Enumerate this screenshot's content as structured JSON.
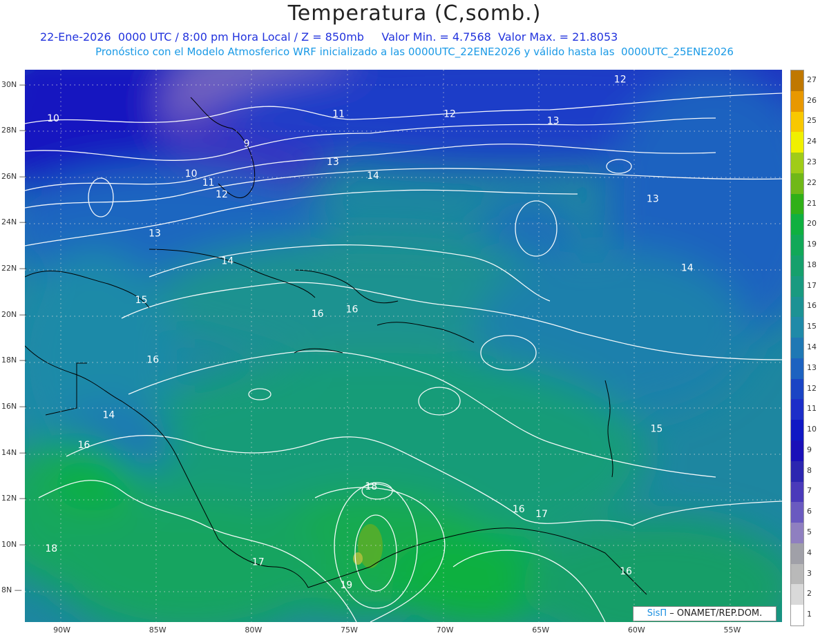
{
  "title": "Temperatura (C,somb.)",
  "subtitle_line1": "22-Ene-2026  0000 UTC / 8:00 pm Hora Local / Z = 850mb     Valor Min. = 4.7568  Valor Max. = 21.8053",
  "subtitle_line2": "Pronóstico con el Modelo Atmosferico WRF inicializado a las 0000UTC_22ENE2026 y válido hasta las  0000UTC_25ENE2026",
  "axes": {
    "lon_labels": [
      "90W",
      "85W",
      "80W",
      "75W",
      "70W",
      "65W",
      "60W",
      "55W"
    ],
    "lat_labels": [
      "30N",
      "28N",
      "26N",
      "24N",
      "22N",
      "20N",
      "18N",
      "16N",
      "14N",
      "12N",
      "10N",
      "8N"
    ],
    "grid": "dotted"
  },
  "contour_labels": [
    {
      "text": "12",
      "lon": -60.8,
      "lat": 30.1
    },
    {
      "text": "10",
      "lon": -90.4,
      "lat": 28.4
    },
    {
      "text": "11",
      "lon": -75.5,
      "lat": 28.6
    },
    {
      "text": "12",
      "lon": -69.7,
      "lat": 28.6
    },
    {
      "text": "13",
      "lon": -64.3,
      "lat": 28.3
    },
    {
      "text": "9",
      "lon": -80.3,
      "lat": 27.3
    },
    {
      "text": "13",
      "lon": -75.8,
      "lat": 26.5
    },
    {
      "text": "14",
      "lon": -73.7,
      "lat": 25.9
    },
    {
      "text": "10",
      "lon": -83.2,
      "lat": 26.0
    },
    {
      "text": "11",
      "lon": -82.3,
      "lat": 25.6
    },
    {
      "text": "12",
      "lon": -81.6,
      "lat": 25.1
    },
    {
      "text": "13",
      "lon": -59.1,
      "lat": 24.9
    },
    {
      "text": "13",
      "lon": -85.1,
      "lat": 23.4
    },
    {
      "text": "14",
      "lon": -81.3,
      "lat": 22.2
    },
    {
      "text": "14",
      "lon": -57.3,
      "lat": 21.9
    },
    {
      "text": "15",
      "lon": -85.8,
      "lat": 20.5
    },
    {
      "text": "16",
      "lon": -76.6,
      "lat": 19.9
    },
    {
      "text": "16",
      "lon": -74.8,
      "lat": 20.1
    },
    {
      "text": "16",
      "lon": -85.2,
      "lat": 17.9
    },
    {
      "text": "14",
      "lon": -87.5,
      "lat": 15.5
    },
    {
      "text": "15",
      "lon": -58.9,
      "lat": 14.9
    },
    {
      "text": "16",
      "lon": -88.8,
      "lat": 14.2
    },
    {
      "text": "18",
      "lon": -73.8,
      "lat": 12.4
    },
    {
      "text": "16",
      "lon": -66.1,
      "lat": 11.4
    },
    {
      "text": "17",
      "lon": -64.9,
      "lat": 11.2
    },
    {
      "text": "18",
      "lon": -90.5,
      "lat": 9.7
    },
    {
      "text": "17",
      "lon": -79.7,
      "lat": 9.1
    },
    {
      "text": "19",
      "lon": -75.1,
      "lat": 8.1
    },
    {
      "text": "16",
      "lon": -60.5,
      "lat": 8.7
    }
  ],
  "colorbar": {
    "labels": [
      "1",
      "2",
      "3",
      "4",
      "5",
      "6",
      "7",
      "8",
      "9",
      "10",
      "11",
      "12",
      "13",
      "14",
      "15",
      "16",
      "17",
      "18",
      "19",
      "20",
      "21",
      "22",
      "23",
      "24",
      "25",
      "26",
      "27"
    ],
    "colors": [
      "#ffffff",
      "#d9d9d9",
      "#b9b9b9",
      "#a0a0a8",
      "#8f7fc0",
      "#6a5ac0",
      "#4a3aba",
      "#2c26b0",
      "#1a10b8",
      "#1018c4",
      "#1c2ec8",
      "#1a44c4",
      "#1d62c0",
      "#1f78b4",
      "#1f8aa8",
      "#1c9294",
      "#199a80",
      "#16a06c",
      "#12a858",
      "#10b040",
      "#30b018",
      "#70b818",
      "#a0cc18",
      "#f0f000",
      "#f8c800",
      "#e89800",
      "#c07800"
    ]
  },
  "credit": {
    "sis": "SisΠ",
    "text": " – ONAMET/REP.DOM."
  },
  "colors": {
    "title": "#222222",
    "subtitle1": "#2233dd",
    "subtitle2": "#1a9ae6",
    "contour": "#ffffff",
    "coast": "#000000"
  }
}
